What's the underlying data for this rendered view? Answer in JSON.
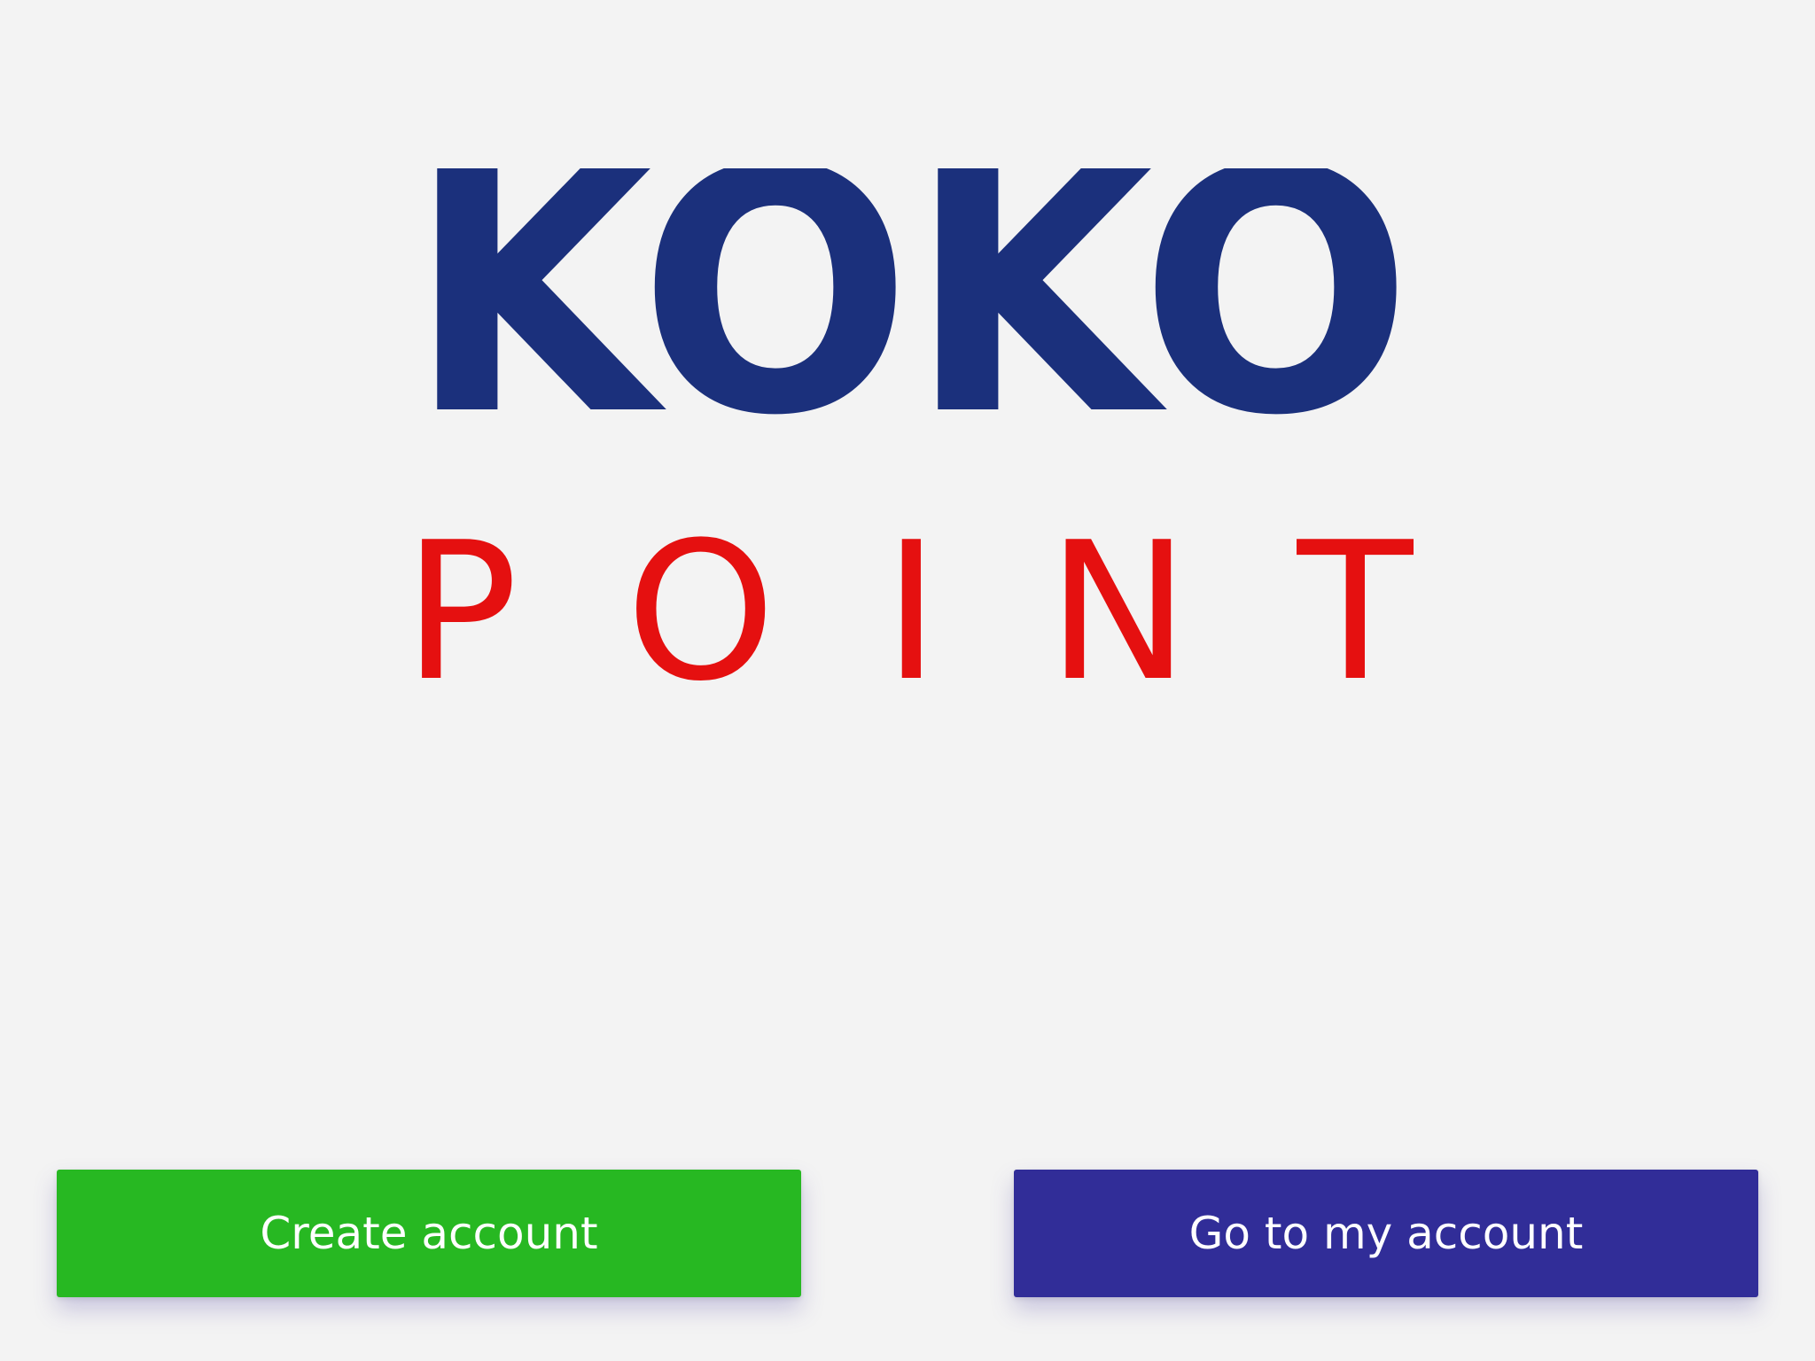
{
  "logo": {
    "brand_name": "KOKO",
    "subtitle": "POINT"
  },
  "actions": {
    "create_label": "Create account",
    "login_label": "Go to my account"
  },
  "colors": {
    "background": "#f3f3f3",
    "brand_blue": "#1b307c",
    "brand_red": "#e51010",
    "create_green": "#27b822",
    "account_indigo": "#312d98"
  }
}
